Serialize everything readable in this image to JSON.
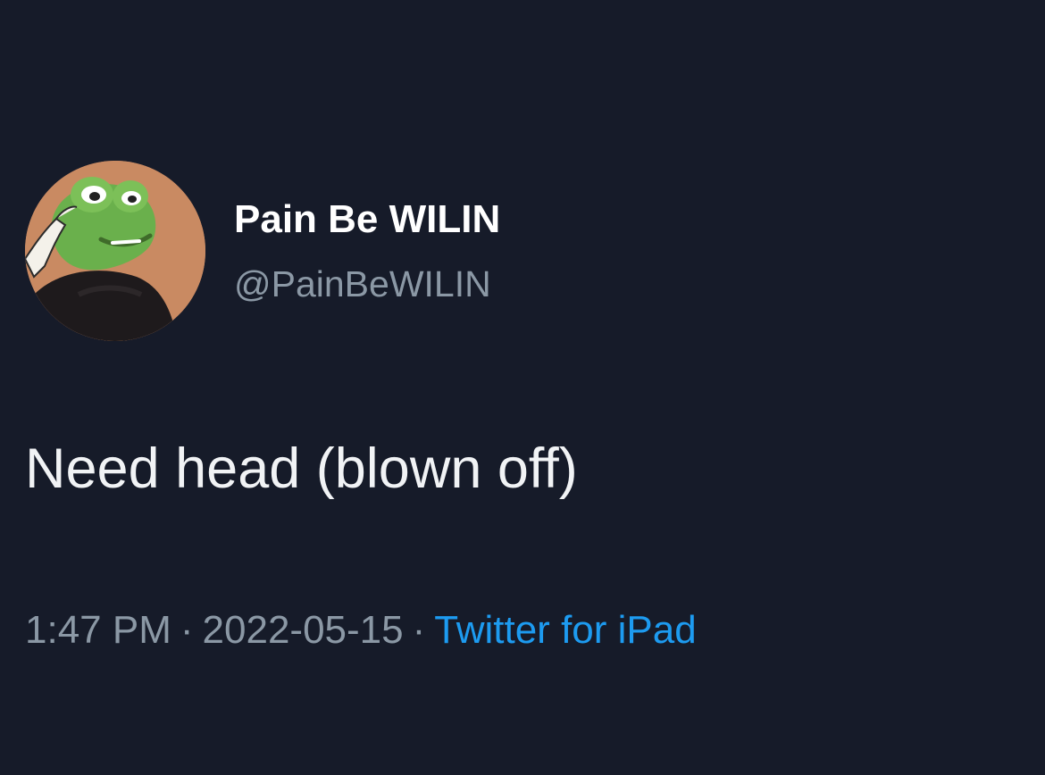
{
  "tweet": {
    "display_name": "Pain Be WILIN",
    "handle": "@PainBeWILIN",
    "text": "Need head (blown off)",
    "time": "1:47 PM",
    "separator": "·",
    "date": "2022-05-15",
    "source": "Twitter for iPad"
  },
  "colors": {
    "background": "#161b29",
    "name": "#ffffff",
    "secondary_text": "#8b98a5",
    "link": "#1d9bf0",
    "avatar_background": "#c98a62"
  },
  "icons": {
    "avatar": "frog-avatar-icon"
  }
}
